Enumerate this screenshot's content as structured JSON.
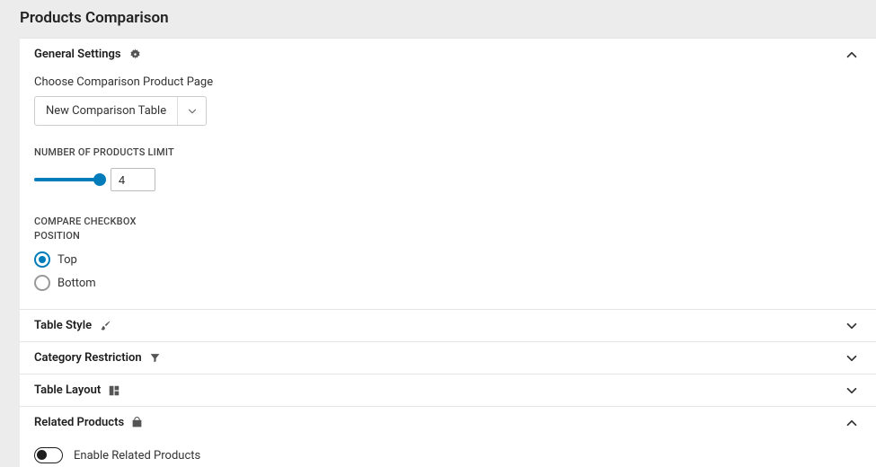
{
  "page": {
    "title": "Products Comparison"
  },
  "sections": {
    "general": {
      "title": "General Settings",
      "expanded": true,
      "choose_label": "Choose Comparison Product Page",
      "product_page_value": "New Comparison Table",
      "limit_label": "NUMBER OF PRODUCTS LIMIT",
      "limit_value": "4",
      "checkbox_pos_label": "COMPARE CHECKBOX POSITION",
      "radio_options": {
        "top": "Top",
        "bottom": "Bottom"
      },
      "radio_selected": "top"
    },
    "table_style": {
      "title": "Table Style",
      "expanded": false
    },
    "category_restriction": {
      "title": "Category Restriction",
      "expanded": false
    },
    "table_layout": {
      "title": "Table Layout",
      "expanded": false
    },
    "related_products": {
      "title": "Related Products",
      "expanded": true,
      "enable_label": "Enable Related Products",
      "enable_value": false
    }
  }
}
